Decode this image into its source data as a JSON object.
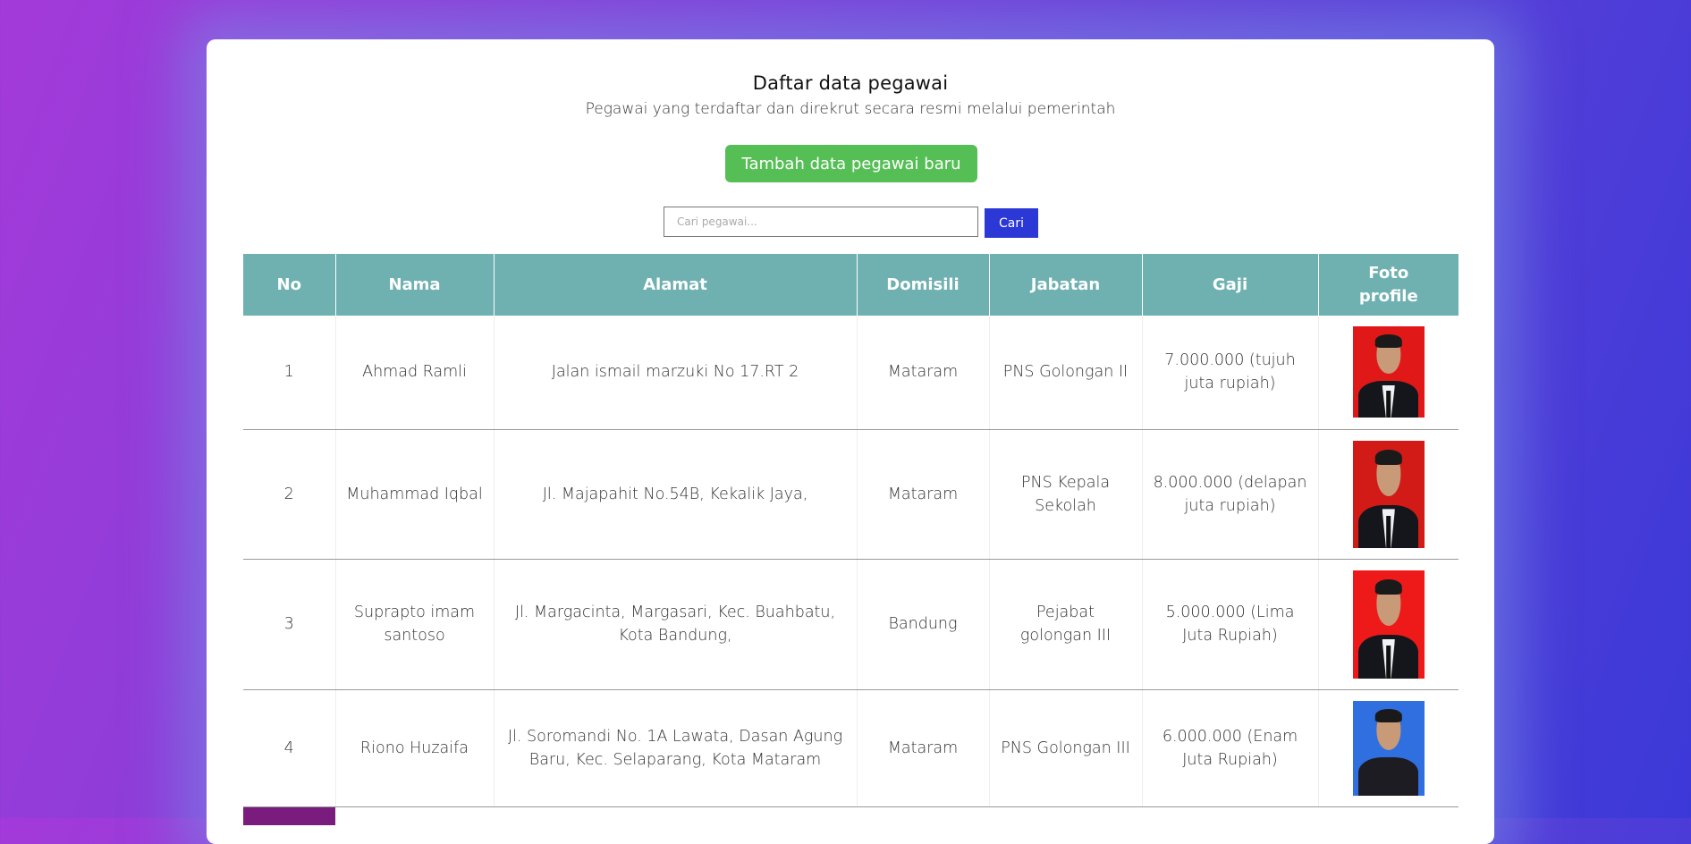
{
  "header": {
    "title": "Daftar data pegawai",
    "subtitle": "Pegawai yang terdaftar dan direkrut secara resmi melalui pemerintah"
  },
  "actions": {
    "add_label": "Tambah data pegawai baru",
    "add_color": "#55bf55"
  },
  "search": {
    "placeholder": "Cari pegawai...",
    "value": "",
    "button_label": "Cari",
    "button_color": "#2b38d6"
  },
  "table": {
    "header_color": "#6fb0b0",
    "columns": [
      "No",
      "Nama",
      "Alamat",
      "Domisili",
      "Jabatan",
      "Gaji",
      "Foto profile"
    ],
    "rows": [
      {
        "no": "1",
        "nama": "Ahmad Ramli",
        "alamat": "Jalan ismail marzuki No 17.RT 2",
        "domisili": "Mataram",
        "jabatan": "PNS Golongan II",
        "gaji": "7.000.000 (tujuh juta rupiah)",
        "foto_bg": "#e01818"
      },
      {
        "no": "2",
        "nama": "Muhammad Iqbal",
        "alamat": "Jl. Majapahit No.54B, Kekalik Jaya,",
        "domisili": "Mataram",
        "jabatan": "PNS Kepala Sekolah",
        "gaji": "8.000.000 (delapan juta rupiah)",
        "foto_bg": "#d21a16"
      },
      {
        "no": "3",
        "nama": "Suprapto imam santoso",
        "alamat": "Jl. Margacinta, Margasari, Kec. Buahbatu, Kota Bandung,",
        "domisili": "Bandung",
        "jabatan": "Pejabat golongan III",
        "gaji": "5.000.000 (Lima Juta Rupiah)",
        "foto_bg": "#ee1a1a"
      },
      {
        "no": "4",
        "nama": "Riono Huzaifa",
        "alamat": "Jl. Soromandi No. 1A Lawata, Dasan Agung Baru, Kec. Selaparang, Kota Mataram",
        "domisili": "Mataram",
        "jabatan": "PNS Golongan III",
        "gaji": "6.000.000 (Enam Juta Rupiah)",
        "foto_bg": "#2f6fe0"
      }
    ]
  }
}
